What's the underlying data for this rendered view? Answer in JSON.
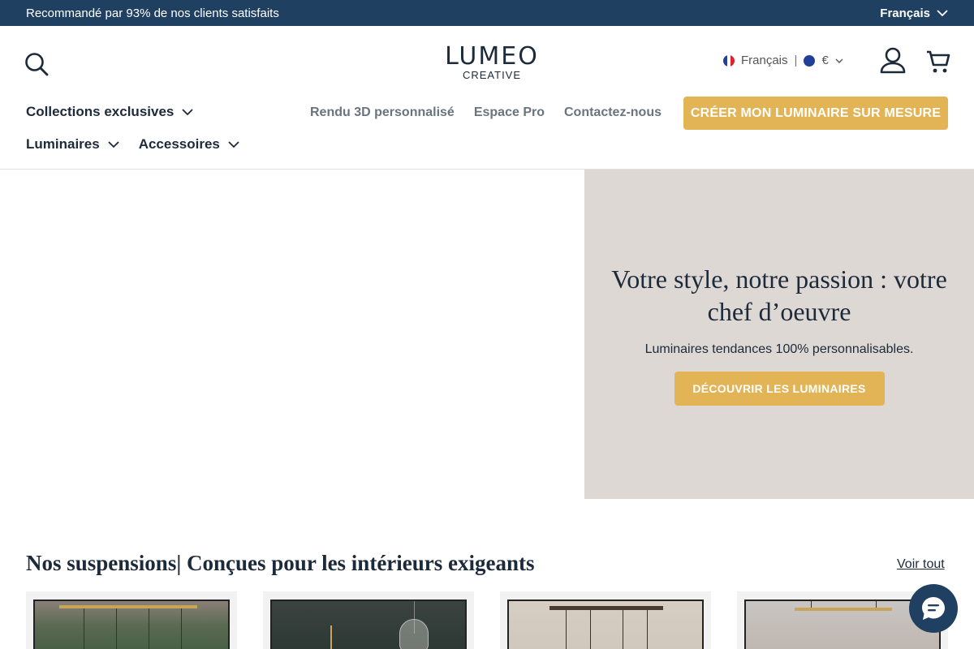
{
  "announcement": {
    "text": "Recommandé par 93% de nos clients satisfaits",
    "language": "Français"
  },
  "header": {
    "logo_main": "LUMEO",
    "logo_sub": "CREATIVE",
    "locale_language": "Français",
    "locale_currency": "€"
  },
  "nav": {
    "row1": [
      {
        "label": "Collections exclusives"
      }
    ],
    "row2": [
      {
        "label": "Luminaires"
      },
      {
        "label": "Accessoires"
      }
    ],
    "links": [
      "Rendu 3D personnalisé",
      "Espace Pro",
      "Contactez-nous"
    ],
    "cta": "CRÉER MON LUMINAIRE SUR MESURE"
  },
  "hero": {
    "title": "Votre style, notre passion : votre chef d’oeuvre",
    "subtitle": "Luminaires tendances 100% personnalisables.",
    "button": "DÉCOUVRIR LES LUMINAIRES"
  },
  "section": {
    "title": "Nos suspensions| Conçues pour les intérieurs exigeants",
    "see_all": "Voir tout"
  },
  "colors": {
    "topbar": "#1f4061",
    "accent": "#e2b456",
    "hero_panel": "#ddd8d4"
  }
}
